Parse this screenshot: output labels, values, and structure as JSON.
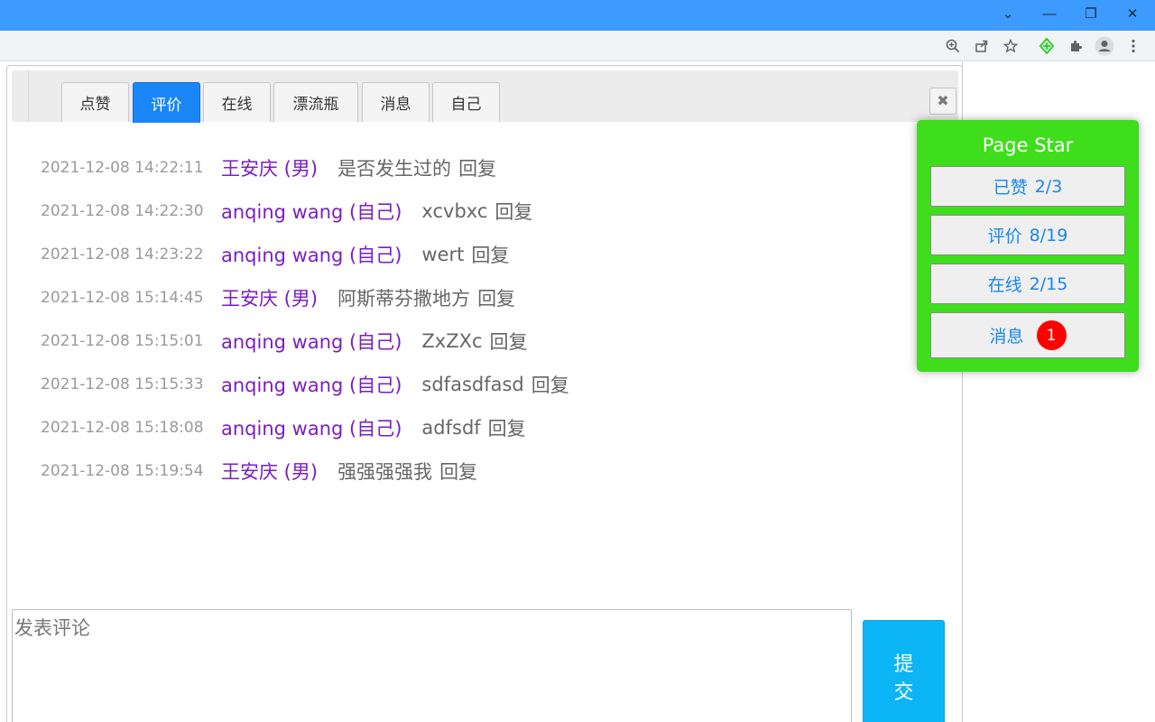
{
  "browser": {
    "window_controls": {
      "dropdown": "⌄",
      "minimize": "—",
      "restore": "❐",
      "close": "✕"
    },
    "toolbar_icons": [
      "zoom-icon",
      "share-icon",
      "star-icon",
      "extension-green-icon",
      "puzzle-icon",
      "profile-icon",
      "menu-icon"
    ]
  },
  "tabs": [
    {
      "label": "点赞",
      "active": false
    },
    {
      "label": "评价",
      "active": true
    },
    {
      "label": "在线",
      "active": false
    },
    {
      "label": "漂流瓶",
      "active": false
    },
    {
      "label": "消息",
      "active": false
    },
    {
      "label": "自己",
      "active": false
    }
  ],
  "close_glyph": "✖",
  "comments": [
    {
      "time": "2021-12-08 14:22:11",
      "user": "王安庆 (男)",
      "message": "是否发生过的",
      "reply": "回复"
    },
    {
      "time": "2021-12-08 14:22:30",
      "user": "anqing wang (自己)",
      "message": "xcvbxc",
      "reply": "回复"
    },
    {
      "time": "2021-12-08 14:23:22",
      "user": "anqing wang (自己)",
      "message": "wert",
      "reply": "回复"
    },
    {
      "time": "2021-12-08 15:14:45",
      "user": "王安庆 (男)",
      "message": "阿斯蒂芬撒地方",
      "reply": "回复"
    },
    {
      "time": "2021-12-08 15:15:01",
      "user": "anqing wang (自己)",
      "message": "ZxZXc",
      "reply": "回复"
    },
    {
      "time": "2021-12-08 15:15:33",
      "user": "anqing wang (自己)",
      "message": "sdfasdfasd",
      "reply": "回复"
    },
    {
      "time": "2021-12-08 15:18:08",
      "user": "anqing wang (自己)",
      "message": "adfsdf",
      "reply": "回复"
    },
    {
      "time": "2021-12-08 15:19:54",
      "user": "王安庆 (男)",
      "message": "强强强强我",
      "reply": "回复"
    }
  ],
  "comment_input": {
    "placeholder": "发表评论",
    "value": ""
  },
  "submit_label": "提交",
  "page_star": {
    "title": "Page Star",
    "buttons": [
      {
        "label": "已赞",
        "count": "2/3"
      },
      {
        "label": "评价",
        "count": "8/19"
      },
      {
        "label": "在线",
        "count": "2/15"
      },
      {
        "label": "消息",
        "badge": "1"
      }
    ],
    "colors": {
      "background": "#3ede1c",
      "link": "#1a86e8",
      "badge": "#ff0000"
    }
  },
  "colors": {
    "titlebar": "#3d9aff",
    "active_tab": "#1b86f5",
    "username": "#7a1ec2",
    "submit": "#0bb5f6"
  }
}
